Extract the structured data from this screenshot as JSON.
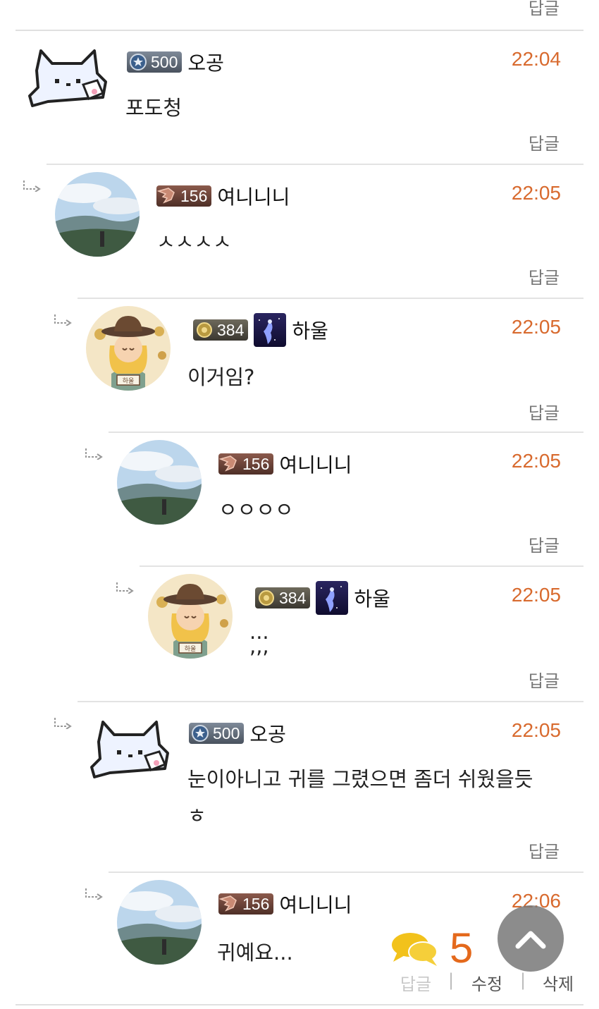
{
  "top": {
    "reply_label": "답글"
  },
  "comments": [
    {
      "nickname": "오공",
      "level": "500",
      "time": "22:04",
      "text": "포도청",
      "reply_label": "답글"
    },
    {
      "nickname": "여니니니",
      "level": "156",
      "time": "22:05",
      "text": "ㅅㅅㅅㅅ",
      "reply_label": "답글"
    },
    {
      "nickname": "하울",
      "level": "384",
      "time": "22:05",
      "text": "이거임?",
      "reply_label": "답글",
      "avatar_tag": "하울"
    },
    {
      "nickname": "여니니니",
      "level": "156",
      "time": "22:05",
      "text": "ㅇㅇㅇㅇ",
      "reply_label": "답글"
    },
    {
      "nickname": "하울",
      "level": "384",
      "time": "22:05",
      "text_line1": "...",
      "text_line2": ",,,",
      "reply_label": "답글",
      "avatar_tag": "하울"
    },
    {
      "nickname": "오공",
      "level": "500",
      "time": "22:05",
      "text_line1": "눈이아니고 귀를 그렸으면 좀더 쉬웠을듯",
      "text_line2": "ㅎ",
      "reply_label": "답글"
    },
    {
      "nickname": "여니니니",
      "level": "156",
      "time": "22:06",
      "text": "귀예요..."
    }
  ],
  "floating": {
    "comment_count": "5",
    "reply_label": "답글",
    "separator": "|",
    "edit_label": "수정",
    "delete_label": "삭제"
  },
  "colors": {
    "time": "#d86a2e",
    "count": "#e4691c"
  }
}
